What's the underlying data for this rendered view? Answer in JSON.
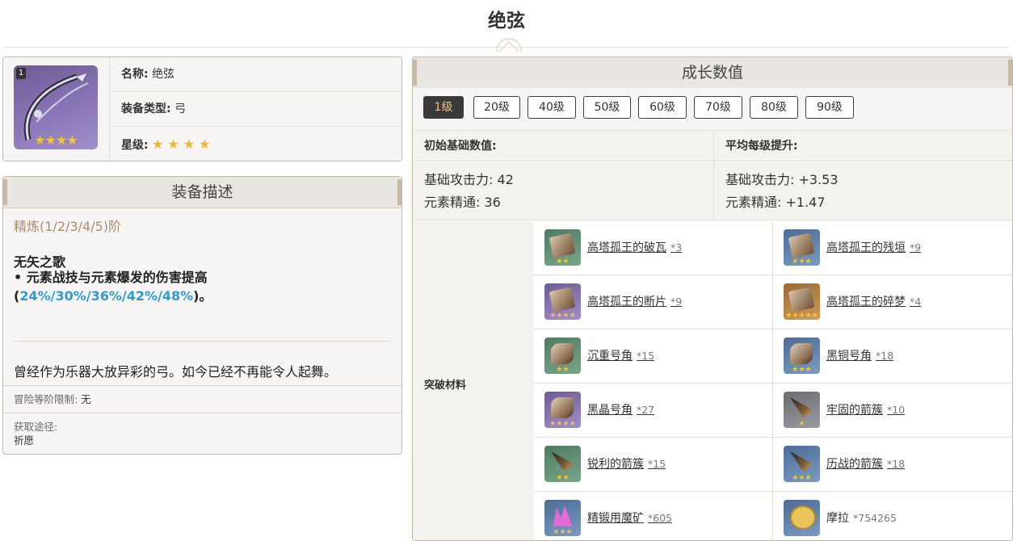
{
  "page": {
    "title": "绝弦"
  },
  "weapon": {
    "refine_badge": "1",
    "name_label": "名称:",
    "name": "绝弦",
    "type_label": "装备类型:",
    "type": "弓",
    "rarity_label": "星级:",
    "rarity_stars": "★★★★",
    "rarity": 4
  },
  "description": {
    "header": "装备描述",
    "refine_levels": "精炼(1/2/3/4/5)阶",
    "skill_name": "无矢之歌",
    "skill_text_prefix": "• 元素战技与元素爆发的伤害提高(",
    "skill_values": "24%/30%/36%/42%/48%",
    "skill_text_suffix": ")。",
    "flavor": "曾经作为乐器大放异彩的弓。如今已经不再能令人起舞。",
    "adventure_rank_label": "冒险等阶限制:",
    "adventure_rank_value": "无",
    "obtain_label": "获取途径:",
    "obtain_value": "祈愿"
  },
  "growth": {
    "header": "成长数值",
    "levels": [
      "1级",
      "20级",
      "40级",
      "50级",
      "60级",
      "70级",
      "80级",
      "90级"
    ],
    "active_level": "1级",
    "base_header": "初始基础数值:",
    "avg_header": "平均每级提升:",
    "base_stats": [
      "基础攻击力: 42",
      "元素精通: 36"
    ],
    "avg_stats": [
      "基础攻击力: +3.53",
      "元素精通: +1.47"
    ],
    "materials_label": "突破材料",
    "materials": [
      {
        "name": "高塔孤王的破瓦",
        "qty": "*3",
        "icon": "tile-fragment-icon",
        "stars": "★★"
      },
      {
        "name": "高塔孤王的残垣",
        "qty": "*9",
        "icon": "ruined-wall-icon",
        "stars": "★★★"
      },
      {
        "name": "高塔孤王的断片",
        "qty": "*9",
        "icon": "broken-piece-icon",
        "stars": "★★★★"
      },
      {
        "name": "高塔孤王的碎梦",
        "qty": "*4",
        "icon": "shattered-dream-icon",
        "stars": "★★★★★"
      },
      {
        "name": "沉重号角",
        "qty": "*15",
        "icon": "heavy-horn-icon",
        "stars": "★★"
      },
      {
        "name": "黑铜号角",
        "qty": "*18",
        "icon": "black-bronze-horn-icon",
        "stars": "★★★"
      },
      {
        "name": "黑晶号角",
        "qty": "*27",
        "icon": "black-crystal-horn-icon",
        "stars": "★★★★"
      },
      {
        "name": "牢固的箭簇",
        "qty": "*10",
        "icon": "firm-arrowhead-icon",
        "stars": "★"
      },
      {
        "name": "锐利的箭簇",
        "qty": "*15",
        "icon": "sharp-arrowhead-icon",
        "stars": "★★"
      },
      {
        "name": "历战的箭簇",
        "qty": "*18",
        "icon": "weathered-arrowhead-icon",
        "stars": "★★★"
      },
      {
        "name": "精锻用魔矿",
        "qty": "*605",
        "icon": "mystic-ore-icon",
        "stars": "★★★"
      },
      {
        "name": "摩拉",
        "qty": "*754265",
        "icon": "mora-coin-icon",
        "stars": ""
      }
    ]
  },
  "colors": {
    "accent_gold": "#f3b626",
    "highlight_blue": "#2d9bd6",
    "refine_brown": "#a88c6e",
    "active_level_bg": "#3b3a3a"
  }
}
